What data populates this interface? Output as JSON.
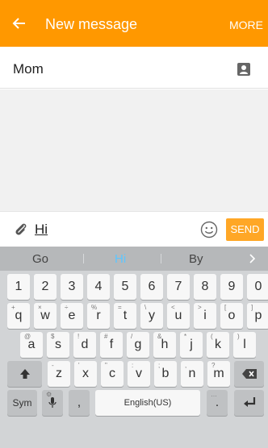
{
  "header": {
    "title": "New message",
    "more_label": "MORE"
  },
  "recipient": {
    "name": "Mom"
  },
  "compose": {
    "text": "Hi",
    "send_label": "SEND"
  },
  "suggestions": [
    "Go",
    "Hi",
    "By"
  ],
  "keyboard": {
    "numbers": [
      "1",
      "2",
      "3",
      "4",
      "5",
      "6",
      "7",
      "8",
      "9",
      "0"
    ],
    "row1": [
      {
        "k": "q",
        "h": "+"
      },
      {
        "k": "w",
        "h": "×"
      },
      {
        "k": "e",
        "h": "÷"
      },
      {
        "k": "r",
        "h": "%"
      },
      {
        "k": "t",
        "h": "="
      },
      {
        "k": "y",
        "h": "\\"
      },
      {
        "k": "u",
        "h": "<"
      },
      {
        "k": "i",
        "h": ">"
      },
      {
        "k": "o",
        "h": "["
      },
      {
        "k": "p",
        "h": "]"
      }
    ],
    "row2": [
      {
        "k": "a",
        "h": "@"
      },
      {
        "k": "s",
        "h": "$"
      },
      {
        "k": "d",
        "h": "!"
      },
      {
        "k": "f",
        "h": "#"
      },
      {
        "k": "g",
        "h": "/"
      },
      {
        "k": "h",
        "h": "&"
      },
      {
        "k": "j",
        "h": "*"
      },
      {
        "k": "k",
        "h": "("
      },
      {
        "k": "l",
        "h": ")"
      }
    ],
    "row3": [
      {
        "k": "z",
        "h": "-"
      },
      {
        "k": "x",
        "h": "'"
      },
      {
        "k": "c",
        "h": "\""
      },
      {
        "k": "v",
        "h": ":"
      },
      {
        "k": "b",
        "h": ";"
      },
      {
        "k": "n",
        "h": ","
      },
      {
        "k": "m",
        "h": "?"
      }
    ],
    "sym_label": "Sym",
    "comma_label": ",",
    "space_label": "English(US)",
    "period_label": ".",
    "mic_hint": "⚙",
    "period_hint": "…"
  },
  "colors": {
    "accent": "#ff9800",
    "send": "#ffa726",
    "suggest_active": "#5ec6ff"
  },
  "icons": {
    "back": "arrow-left-icon",
    "contact": "contact-card-icon",
    "attach": "paperclip-icon",
    "emoji": "smiley-icon"
  }
}
